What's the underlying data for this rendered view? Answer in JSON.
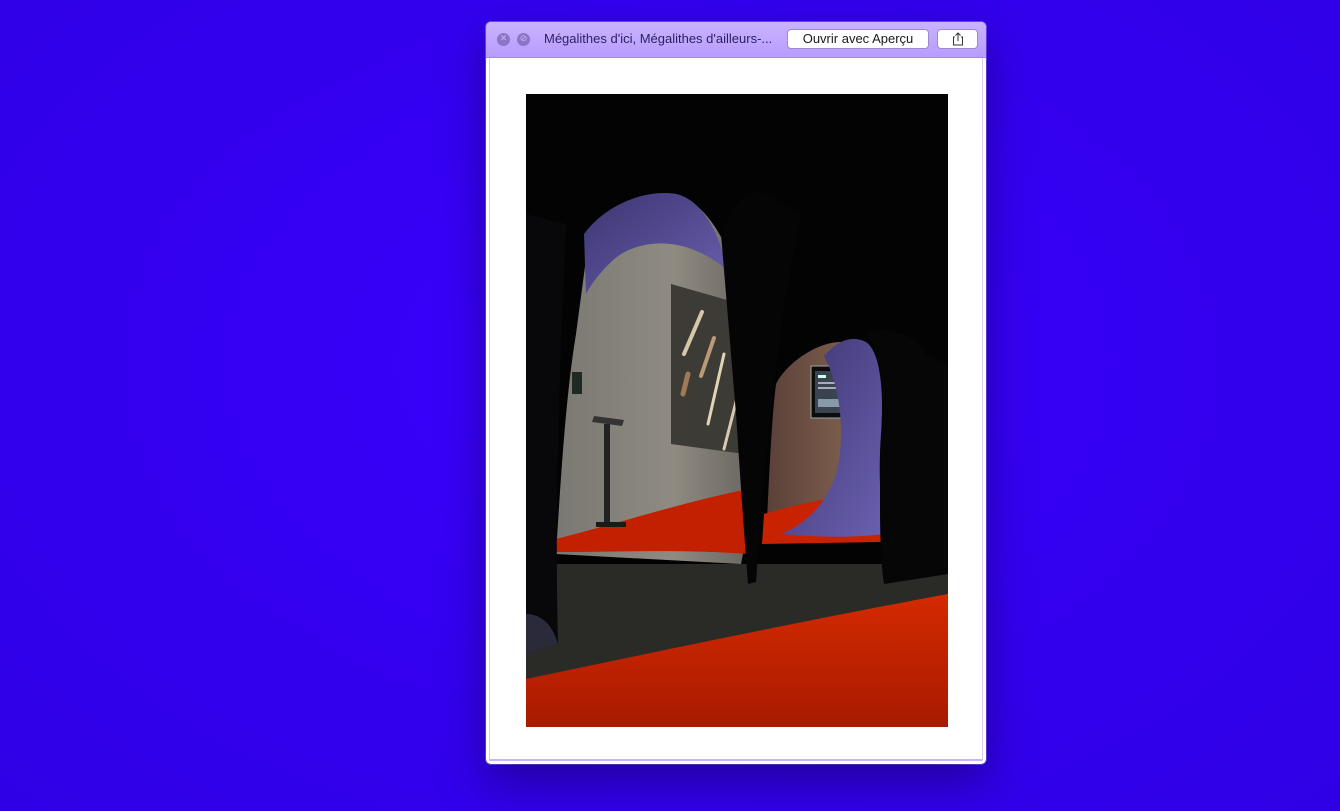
{
  "window": {
    "title": "Mégalithes d'ici, Mégalithes d'ailleurs-...",
    "open_button_label": "Ouvrir avec Aperçu",
    "close_icon": "close-icon",
    "minimize_icon": "fullscreen-disabled-icon",
    "share_icon": "share-icon"
  },
  "colors": {
    "desktop_background": "#3300ee",
    "titlebar": "#c0a8ff",
    "floor_red": "#c81e00",
    "fabric_purple": "#4a3f8c"
  }
}
